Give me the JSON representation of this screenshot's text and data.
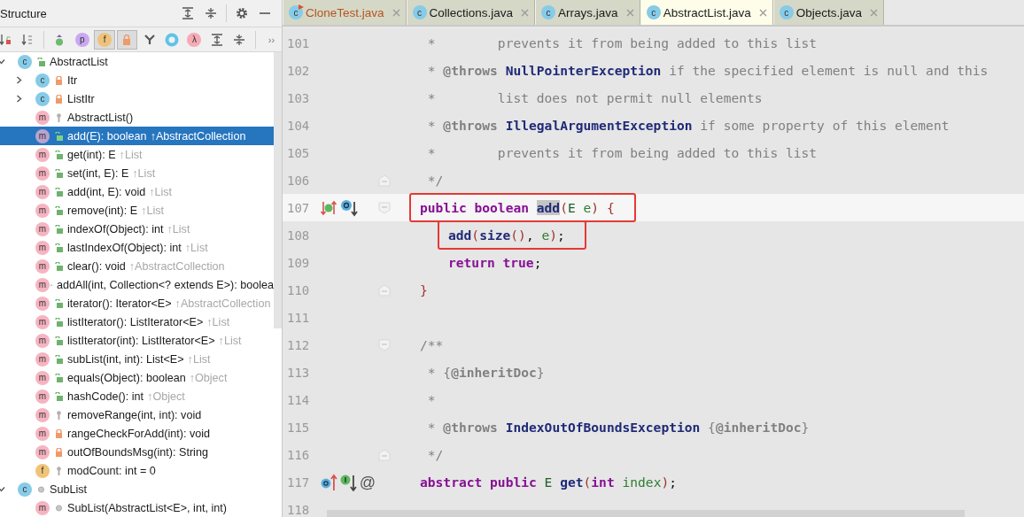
{
  "structure_panel": {
    "title": "Structure",
    "header_tools": [
      {
        "kind": "expand-all"
      },
      {
        "kind": "collapse-all"
      },
      {
        "kind": "settings"
      },
      {
        "kind": "minimize"
      }
    ],
    "toolbar": [
      {
        "kind": "sort-visibility",
        "on": false
      },
      {
        "kind": "sort-alpha",
        "on": false
      },
      {
        "kind": "inherited",
        "on": false
      },
      {
        "kind": "letter",
        "glyph": "p",
        "color": "#c9a8f0",
        "on": false
      },
      {
        "kind": "letter",
        "glyph": "f",
        "color": "#eec27a",
        "on": true
      },
      {
        "kind": "lock",
        "on": true
      },
      {
        "kind": "fork",
        "on": false
      },
      {
        "kind": "ring",
        "on": false
      },
      {
        "kind": "letter",
        "glyph": "λ",
        "color": "#f6aab6",
        "on": false
      },
      {
        "kind": "expand",
        "on": false
      },
      {
        "kind": "collapse",
        "on": false
      },
      {
        "kind": "more",
        "glyph": "››",
        "on": false
      }
    ],
    "tree": [
      {
        "kind": "class",
        "glyph": "c",
        "modifier": {
          "kind": "public"
        },
        "label": "AbstractList",
        "expanded": true,
        "selected": false,
        "children": [
          {
            "kind": "class",
            "glyph": "c",
            "modifier": {
              "kind": "private"
            },
            "label": "Itr",
            "expanded": false,
            "selected": false
          },
          {
            "kind": "class",
            "glyph": "c",
            "modifier": {
              "kind": "private"
            },
            "label": "ListItr",
            "expanded": false,
            "selected": false
          },
          {
            "kind": "method",
            "glyph": "m",
            "modifier": {
              "kind": "protected"
            },
            "label": "AbstractList()",
            "selected": false
          },
          {
            "kind": "method",
            "glyph": "m",
            "modifier": {
              "kind": "public"
            },
            "label": "add(E): boolean",
            "inherited": "↑AbstractCollection",
            "selected": true
          },
          {
            "kind": "method",
            "glyph": "m",
            "modifier": {
              "kind": "public"
            },
            "label": "get(int): E",
            "inherited": "↑List",
            "selected": false
          },
          {
            "kind": "method",
            "glyph": "m",
            "modifier": {
              "kind": "public"
            },
            "label": "set(int, E): E",
            "inherited": "↑List",
            "selected": false
          },
          {
            "kind": "method",
            "glyph": "m",
            "modifier": {
              "kind": "public"
            },
            "label": "add(int, E): void",
            "inherited": "↑List",
            "selected": false
          },
          {
            "kind": "method",
            "glyph": "m",
            "modifier": {
              "kind": "public"
            },
            "label": "remove(int): E",
            "inherited": "↑List",
            "selected": false
          },
          {
            "kind": "method",
            "glyph": "m",
            "modifier": {
              "kind": "public"
            },
            "label": "indexOf(Object): int",
            "inherited": "↑List",
            "selected": false
          },
          {
            "kind": "method",
            "glyph": "m",
            "modifier": {
              "kind": "public"
            },
            "label": "lastIndexOf(Object): int",
            "inherited": "↑List",
            "selected": false
          },
          {
            "kind": "method",
            "glyph": "m",
            "modifier": {
              "kind": "public"
            },
            "label": "clear(): void",
            "inherited": "↑AbstractCollection",
            "selected": false
          },
          {
            "kind": "method",
            "glyph": "m",
            "modifier": {
              "kind": "public"
            },
            "label": "addAll(int, Collection<? extends E>): boolea",
            "selected": false
          },
          {
            "kind": "method",
            "glyph": "m",
            "modifier": {
              "kind": "public"
            },
            "label": "iterator(): Iterator<E>",
            "inherited": "↑AbstractCollection",
            "selected": false
          },
          {
            "kind": "method",
            "glyph": "m",
            "modifier": {
              "kind": "public"
            },
            "label": "listIterator(): ListIterator<E>",
            "inherited": "↑List",
            "selected": false
          },
          {
            "kind": "method",
            "glyph": "m",
            "modifier": {
              "kind": "public"
            },
            "label": "listIterator(int): ListIterator<E>",
            "inherited": "↑List",
            "selected": false
          },
          {
            "kind": "method",
            "glyph": "m",
            "modifier": {
              "kind": "public"
            },
            "label": "subList(int, int): List<E>",
            "inherited": "↑List",
            "selected": false
          },
          {
            "kind": "method",
            "glyph": "m",
            "modifier": {
              "kind": "public"
            },
            "label": "equals(Object): boolean",
            "inherited": "↑Object",
            "selected": false
          },
          {
            "kind": "method",
            "glyph": "m",
            "modifier": {
              "kind": "public"
            },
            "label": "hashCode(): int",
            "inherited": "↑Object",
            "selected": false
          },
          {
            "kind": "method",
            "glyph": "m",
            "modifier": {
              "kind": "protected"
            },
            "label": "removeRange(int, int): void",
            "selected": false
          },
          {
            "kind": "method",
            "glyph": "m",
            "modifier": {
              "kind": "private"
            },
            "label": "rangeCheckForAdd(int): void",
            "selected": false
          },
          {
            "kind": "method",
            "glyph": "m",
            "modifier": {
              "kind": "private"
            },
            "label": "outOfBoundsMsg(int): String",
            "selected": false
          },
          {
            "kind": "field",
            "glyph": "f",
            "modifier": {
              "kind": "protected"
            },
            "label": "modCount: int = 0",
            "selected": false
          }
        ]
      },
      {
        "kind": "class",
        "glyph": "c",
        "modifier": {
          "kind": "package"
        },
        "label": "SubList",
        "expanded": true,
        "selected": false,
        "children": [
          {
            "kind": "method",
            "glyph": "m",
            "modifier": {
              "kind": "package"
            },
            "label": "SubList(AbstractList<E>, int, int)",
            "selected": false
          }
        ]
      }
    ]
  },
  "editor": {
    "tabs": [
      {
        "glyph": "c",
        "label": "CloneTest.java",
        "color": "#b5541f",
        "runnable": true,
        "selected": false
      },
      {
        "glyph": "c",
        "label": "Collections.java",
        "color": "#1a1a1a",
        "runnable": false,
        "selected": false
      },
      {
        "glyph": "c",
        "label": "Arrays.java",
        "color": "#1a1a1a",
        "runnable": false,
        "selected": false
      },
      {
        "glyph": "c",
        "label": "AbstractList.java",
        "color": "#1a1a1a",
        "runnable": false,
        "selected": true
      },
      {
        "glyph": "c",
        "label": "Objects.java",
        "color": "#1a1a1a",
        "runnable": false,
        "selected": false
      }
    ],
    "lines": [
      {
        "number": "101",
        "kind": "member",
        "tokens": [
          {
            "kind": "comment",
            "text": " *        prevents it from being added to this list"
          }
        ]
      },
      {
        "number": "102",
        "kind": "member",
        "tokens": [
          {
            "kind": "comment",
            "text": " * "
          },
          {
            "kind": "doctag",
            "text": "@throws"
          },
          {
            "kind": "docref",
            "text": " NullPointerException"
          },
          {
            "kind": "comment",
            "text": " if the specified element is null and this"
          }
        ]
      },
      {
        "number": "103",
        "kind": "member",
        "tokens": [
          {
            "kind": "comment",
            "text": " *        list does not permit null elements"
          }
        ]
      },
      {
        "number": "104",
        "kind": "member",
        "tokens": [
          {
            "kind": "comment",
            "text": " * "
          },
          {
            "kind": "doctag",
            "text": "@throws"
          },
          {
            "kind": "docref",
            "text": " IllegalArgumentException"
          },
          {
            "kind": "comment",
            "text": " if some property of this element"
          }
        ]
      },
      {
        "number": "105",
        "kind": "member",
        "tokens": [
          {
            "kind": "comment",
            "text": " *        prevents it from being added to this list"
          }
        ]
      },
      {
        "number": "106",
        "kind": "member",
        "fold": {
          "kind": "end"
        },
        "tokens": [
          {
            "kind": "comment",
            "text": " */"
          }
        ]
      },
      {
        "number": "107",
        "kind": "member",
        "current": true,
        "boxed": true,
        "fold": {
          "kind": "start"
        },
        "markers": [
          {
            "kind": "implements"
          },
          {
            "kind": "overridden"
          }
        ],
        "tokens": [
          {
            "kind": "keyword",
            "text": "public boolean "
          },
          {
            "kind": "method-highlight",
            "text": "add"
          },
          {
            "kind": "paren",
            "text": "("
          },
          {
            "kind": "type",
            "text": "E "
          },
          {
            "kind": "param",
            "text": "e"
          },
          {
            "kind": "paren",
            "text": ") {"
          }
        ]
      },
      {
        "number": "108",
        "kind": "body",
        "boxed": true,
        "tokens": [
          {
            "kind": "method",
            "text": "add"
          },
          {
            "kind": "paren",
            "text": "("
          },
          {
            "kind": "method",
            "text": "size"
          },
          {
            "kind": "paren",
            "text": "()"
          },
          {
            "kind": "plain",
            "text": ", "
          },
          {
            "kind": "param",
            "text": "e"
          },
          {
            "kind": "paren",
            "text": ")"
          },
          {
            "kind": "plain",
            "text": ";"
          }
        ]
      },
      {
        "number": "109",
        "kind": "body",
        "tokens": [
          {
            "kind": "keyword",
            "text": "return true"
          },
          {
            "kind": "plain",
            "text": ";"
          }
        ]
      },
      {
        "number": "110",
        "kind": "member",
        "fold": {
          "kind": "end"
        },
        "tokens": [
          {
            "kind": "paren",
            "text": "}"
          }
        ]
      },
      {
        "number": "111",
        "kind": "member"
      },
      {
        "number": "112",
        "kind": "member",
        "fold": {
          "kind": "start"
        },
        "tokens": [
          {
            "kind": "comment",
            "text": "/**"
          }
        ]
      },
      {
        "number": "113",
        "kind": "member",
        "tokens": [
          {
            "kind": "comment",
            "text": " * {"
          },
          {
            "kind": "doctag",
            "text": "@inheritDoc"
          },
          {
            "kind": "comment",
            "text": "}"
          }
        ]
      },
      {
        "number": "114",
        "kind": "member",
        "tokens": [
          {
            "kind": "comment",
            "text": " *"
          }
        ]
      },
      {
        "number": "115",
        "kind": "member",
        "tokens": [
          {
            "kind": "comment",
            "text": " * "
          },
          {
            "kind": "doctag",
            "text": "@throws"
          },
          {
            "kind": "docref",
            "text": " IndexOutOfBoundsException"
          },
          {
            "kind": "comment",
            "text": " {"
          },
          {
            "kind": "doctag",
            "text": "@inheritDoc"
          },
          {
            "kind": "comment",
            "text": "}"
          }
        ]
      },
      {
        "number": "116",
        "kind": "member",
        "fold": {
          "kind": "end"
        },
        "tokens": [
          {
            "kind": "comment",
            "text": " */"
          }
        ]
      },
      {
        "number": "117",
        "kind": "member",
        "markers": [
          {
            "kind": "overrides"
          },
          {
            "kind": "implemented"
          },
          {
            "kind": "annotation",
            "glyph": "@"
          }
        ],
        "tokens": [
          {
            "kind": "keyword",
            "text": "abstract public "
          },
          {
            "kind": "type",
            "text": "E "
          },
          {
            "kind": "method",
            "text": "get"
          },
          {
            "kind": "paren",
            "text": "("
          },
          {
            "kind": "keyword",
            "text": "int "
          },
          {
            "kind": "param",
            "text": "index"
          },
          {
            "kind": "paren",
            "text": ")"
          },
          {
            "kind": "plain",
            "text": ";"
          }
        ]
      },
      {
        "number": "118",
        "kind": "member"
      }
    ]
  }
}
